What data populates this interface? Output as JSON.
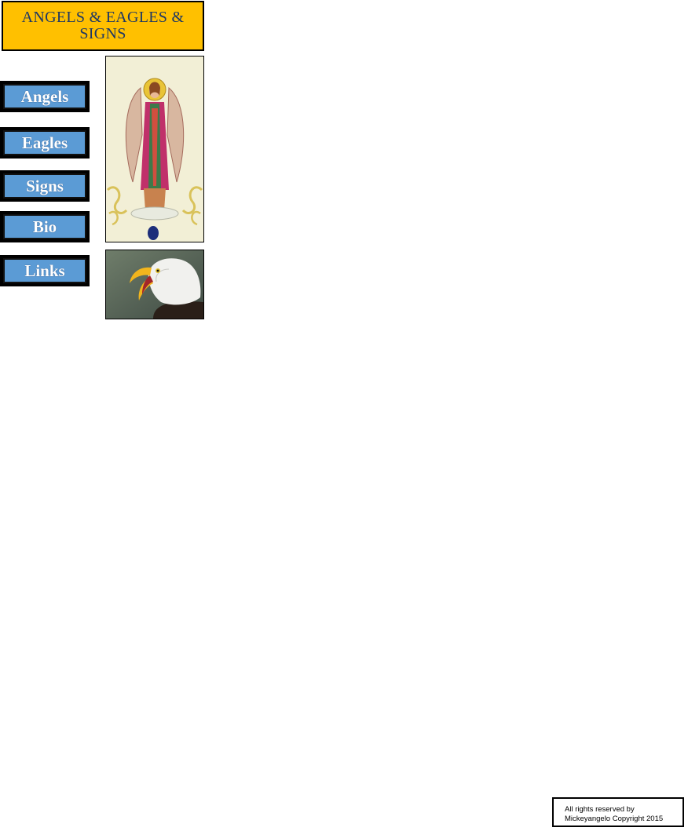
{
  "header": {
    "title": "ANGELS & EAGLES & SIGNS"
  },
  "nav": {
    "items": [
      {
        "label": "Angels"
      },
      {
        "label": "Eagles"
      },
      {
        "label": "Signs"
      },
      {
        "label": "Bio"
      },
      {
        "label": "Links"
      }
    ]
  },
  "images": {
    "angel": {
      "icon": "angel-painting"
    },
    "eagle": {
      "icon": "bald-eagle-photo"
    }
  },
  "footer": {
    "line1": "All rights reserved by",
    "line2": "Mickeyangelo Copyright 2015"
  },
  "colors": {
    "title_bg": "#ffc000",
    "title_text": "#1f3864",
    "nav_bg": "#5b9bd5",
    "nav_text": "#ffffff"
  }
}
